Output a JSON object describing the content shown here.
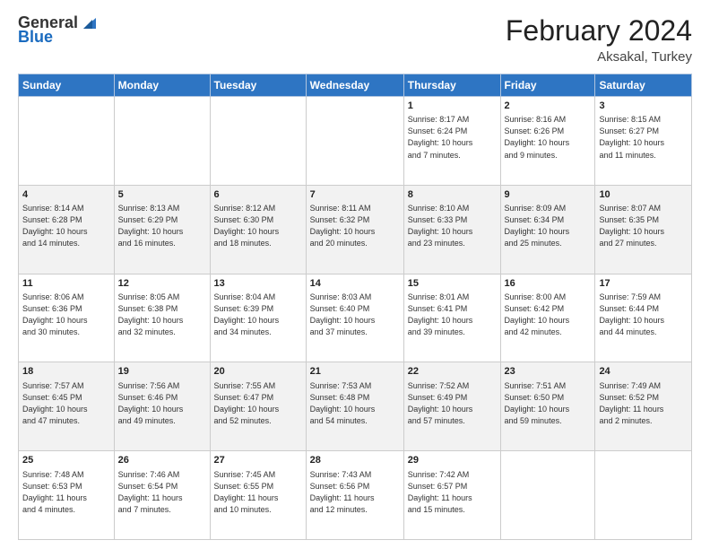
{
  "logo": {
    "general": "General",
    "blue": "Blue"
  },
  "title": "February 2024",
  "subtitle": "Aksakal, Turkey",
  "days_header": [
    "Sunday",
    "Monday",
    "Tuesday",
    "Wednesday",
    "Thursday",
    "Friday",
    "Saturday"
  ],
  "weeks": [
    {
      "shade": false,
      "days": [
        {
          "num": "",
          "info": ""
        },
        {
          "num": "",
          "info": ""
        },
        {
          "num": "",
          "info": ""
        },
        {
          "num": "",
          "info": ""
        },
        {
          "num": "1",
          "info": "Sunrise: 8:17 AM\nSunset: 6:24 PM\nDaylight: 10 hours\nand 7 minutes."
        },
        {
          "num": "2",
          "info": "Sunrise: 8:16 AM\nSunset: 6:26 PM\nDaylight: 10 hours\nand 9 minutes."
        },
        {
          "num": "3",
          "info": "Sunrise: 8:15 AM\nSunset: 6:27 PM\nDaylight: 10 hours\nand 11 minutes."
        }
      ]
    },
    {
      "shade": true,
      "days": [
        {
          "num": "4",
          "info": "Sunrise: 8:14 AM\nSunset: 6:28 PM\nDaylight: 10 hours\nand 14 minutes."
        },
        {
          "num": "5",
          "info": "Sunrise: 8:13 AM\nSunset: 6:29 PM\nDaylight: 10 hours\nand 16 minutes."
        },
        {
          "num": "6",
          "info": "Sunrise: 8:12 AM\nSunset: 6:30 PM\nDaylight: 10 hours\nand 18 minutes."
        },
        {
          "num": "7",
          "info": "Sunrise: 8:11 AM\nSunset: 6:32 PM\nDaylight: 10 hours\nand 20 minutes."
        },
        {
          "num": "8",
          "info": "Sunrise: 8:10 AM\nSunset: 6:33 PM\nDaylight: 10 hours\nand 23 minutes."
        },
        {
          "num": "9",
          "info": "Sunrise: 8:09 AM\nSunset: 6:34 PM\nDaylight: 10 hours\nand 25 minutes."
        },
        {
          "num": "10",
          "info": "Sunrise: 8:07 AM\nSunset: 6:35 PM\nDaylight: 10 hours\nand 27 minutes."
        }
      ]
    },
    {
      "shade": false,
      "days": [
        {
          "num": "11",
          "info": "Sunrise: 8:06 AM\nSunset: 6:36 PM\nDaylight: 10 hours\nand 30 minutes."
        },
        {
          "num": "12",
          "info": "Sunrise: 8:05 AM\nSunset: 6:38 PM\nDaylight: 10 hours\nand 32 minutes."
        },
        {
          "num": "13",
          "info": "Sunrise: 8:04 AM\nSunset: 6:39 PM\nDaylight: 10 hours\nand 34 minutes."
        },
        {
          "num": "14",
          "info": "Sunrise: 8:03 AM\nSunset: 6:40 PM\nDaylight: 10 hours\nand 37 minutes."
        },
        {
          "num": "15",
          "info": "Sunrise: 8:01 AM\nSunset: 6:41 PM\nDaylight: 10 hours\nand 39 minutes."
        },
        {
          "num": "16",
          "info": "Sunrise: 8:00 AM\nSunset: 6:42 PM\nDaylight: 10 hours\nand 42 minutes."
        },
        {
          "num": "17",
          "info": "Sunrise: 7:59 AM\nSunset: 6:44 PM\nDaylight: 10 hours\nand 44 minutes."
        }
      ]
    },
    {
      "shade": true,
      "days": [
        {
          "num": "18",
          "info": "Sunrise: 7:57 AM\nSunset: 6:45 PM\nDaylight: 10 hours\nand 47 minutes."
        },
        {
          "num": "19",
          "info": "Sunrise: 7:56 AM\nSunset: 6:46 PM\nDaylight: 10 hours\nand 49 minutes."
        },
        {
          "num": "20",
          "info": "Sunrise: 7:55 AM\nSunset: 6:47 PM\nDaylight: 10 hours\nand 52 minutes."
        },
        {
          "num": "21",
          "info": "Sunrise: 7:53 AM\nSunset: 6:48 PM\nDaylight: 10 hours\nand 54 minutes."
        },
        {
          "num": "22",
          "info": "Sunrise: 7:52 AM\nSunset: 6:49 PM\nDaylight: 10 hours\nand 57 minutes."
        },
        {
          "num": "23",
          "info": "Sunrise: 7:51 AM\nSunset: 6:50 PM\nDaylight: 10 hours\nand 59 minutes."
        },
        {
          "num": "24",
          "info": "Sunrise: 7:49 AM\nSunset: 6:52 PM\nDaylight: 11 hours\nand 2 minutes."
        }
      ]
    },
    {
      "shade": false,
      "days": [
        {
          "num": "25",
          "info": "Sunrise: 7:48 AM\nSunset: 6:53 PM\nDaylight: 11 hours\nand 4 minutes."
        },
        {
          "num": "26",
          "info": "Sunrise: 7:46 AM\nSunset: 6:54 PM\nDaylight: 11 hours\nand 7 minutes."
        },
        {
          "num": "27",
          "info": "Sunrise: 7:45 AM\nSunset: 6:55 PM\nDaylight: 11 hours\nand 10 minutes."
        },
        {
          "num": "28",
          "info": "Sunrise: 7:43 AM\nSunset: 6:56 PM\nDaylight: 11 hours\nand 12 minutes."
        },
        {
          "num": "29",
          "info": "Sunrise: 7:42 AM\nSunset: 6:57 PM\nDaylight: 11 hours\nand 15 minutes."
        },
        {
          "num": "",
          "info": ""
        },
        {
          "num": "",
          "info": ""
        }
      ]
    }
  ]
}
